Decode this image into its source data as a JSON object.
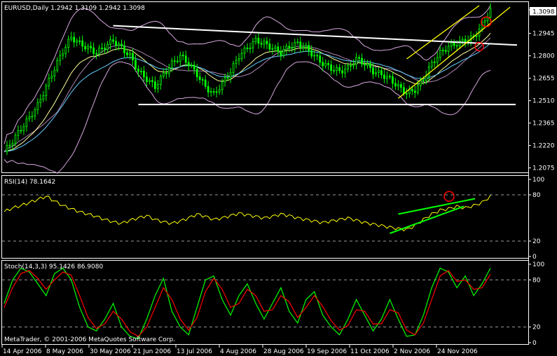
{
  "window": {
    "footer": "MetaTrader, © 2001-2006 MetaQuotes Software Corp."
  },
  "main_panel": {
    "header": "EURUSD,Daily  1.2942 1.3109 1.2942 1.3098",
    "current_price_label": "1.3098"
  },
  "rsi_panel": {
    "header": "RSI(14) 78.1642"
  },
  "stoch_panel": {
    "header": "Stoch(14,3,3) 95.1426 86.9080"
  },
  "colors": {
    "background": "#000000",
    "grid": "#ffffff",
    "candle": "#00ff00",
    "trendline_white": "#ffffff",
    "trendline_yellow": "#ffff00",
    "bollinger": "#d8a8e0",
    "ma_fast": "#ffff99",
    "ma_slow": "#66ccff",
    "rsi_line": "#ffff00",
    "rsi_trend": "#00ff00",
    "stoch_main": "#00ff00",
    "stoch_signal": "#ff0000",
    "highlight_circle": "#ff0000"
  },
  "chart_data": [
    {
      "type": "line",
      "subtype": "candlestick",
      "symbol": "EURUSD",
      "timeframe": "Daily",
      "ohlc_last": {
        "open": 1.2942,
        "high": 1.3109,
        "low": 1.2942,
        "close": 1.3098
      },
      "y_ticks": [
        1.3098,
        1.2945,
        1.28,
        1.2655,
        1.251,
        1.2365,
        1.222,
        1.2075
      ],
      "ylim": [
        1.2055,
        1.3125
      ],
      "x_ticks": [
        "14 Apr 2006",
        "8 May 2006",
        "30 May 2006",
        "21 Jun 2006",
        "13 Jul 2006",
        "4 Aug 2006",
        "28 Aug 2006",
        "19 Sep 2006",
        "11 Oct 2006",
        "2 Nov 2006",
        "24 Nov 2006"
      ],
      "series": [
        {
          "values": [
            1.218,
            1.225,
            1.233,
            1.24,
            1.248,
            1.26,
            1.272,
            1.283,
            1.292,
            1.288,
            1.285,
            1.282,
            1.286,
            1.29,
            1.285,
            1.28,
            1.27,
            1.265,
            1.26,
            1.268,
            1.275,
            1.28,
            1.275,
            1.268,
            1.26,
            1.255,
            1.262,
            1.27,
            1.28,
            1.285,
            1.29,
            1.288,
            1.285,
            1.282,
            1.286,
            1.288,
            1.285,
            1.28,
            1.275,
            1.272,
            1.27,
            1.272,
            1.278,
            1.275,
            1.27,
            1.268,
            1.265,
            1.26,
            1.256,
            1.258,
            1.265,
            1.275,
            1.282,
            1.286,
            1.288,
            1.29,
            1.292,
            1.3,
            1.3098
          ]
        }
      ],
      "annotations": [
        "support line",
        "resistance line",
        "ascending channel",
        "highlight circles"
      ]
    },
    {
      "type": "line",
      "title": "RSI(14) 78.1642",
      "y_ticks": [
        100,
        80,
        20,
        0
      ],
      "ylim": [
        0,
        100
      ],
      "series": [
        {
          "values": [
            58,
            63,
            66,
            70,
            74,
            78,
            72,
            66,
            62,
            58,
            55,
            52,
            48,
            45,
            43,
            47,
            50,
            53,
            48,
            45,
            43,
            46,
            50,
            55,
            52,
            48,
            50,
            53,
            56,
            54,
            52,
            50,
            52,
            55,
            53,
            50,
            48,
            46,
            44,
            46,
            48,
            50,
            47,
            44,
            42,
            40,
            38,
            36,
            35,
            40,
            48,
            55,
            60,
            62,
            65,
            63,
            66,
            70,
            78
          ]
        }
      ],
      "annotations": [
        "RSI trendline upper",
        "RSI trendline lower",
        "highlight circle"
      ]
    },
    {
      "type": "line",
      "title": "Stoch(14,3,3) 95.1426 86.9080",
      "y_ticks": [
        100,
        80,
        20,
        0
      ],
      "ylim": [
        0,
        100
      ],
      "series": [
        {
          "values": [
            50,
            80,
            95,
            90,
            75,
            60,
            88,
            95,
            80,
            45,
            20,
            15,
            30,
            50,
            20,
            8,
            5,
            30,
            60,
            82,
            40,
            20,
            10,
            45,
            80,
            85,
            55,
            35,
            60,
            75,
            50,
            30,
            50,
            70,
            40,
            25,
            55,
            65,
            35,
            20,
            10,
            30,
            55,
            35,
            15,
            30,
            55,
            30,
            8,
            10,
            35,
            70,
            95,
            90,
            70,
            85,
            60,
            75,
            95
          ]
        },
        {
          "values": [
            45,
            70,
            88,
            92,
            82,
            68,
            80,
            90,
            86,
            60,
            32,
            18,
            24,
            40,
            30,
            14,
            8,
            20,
            45,
            70,
            55,
            30,
            16,
            32,
            65,
            82,
            68,
            45,
            50,
            68,
            60,
            40,
            42,
            60,
            52,
            32,
            45,
            60,
            46,
            28,
            16,
            22,
            42,
            40,
            24,
            24,
            42,
            38,
            16,
            10,
            25,
            55,
            85,
            92,
            78,
            80,
            68,
            70,
            87
          ]
        }
      ]
    }
  ]
}
